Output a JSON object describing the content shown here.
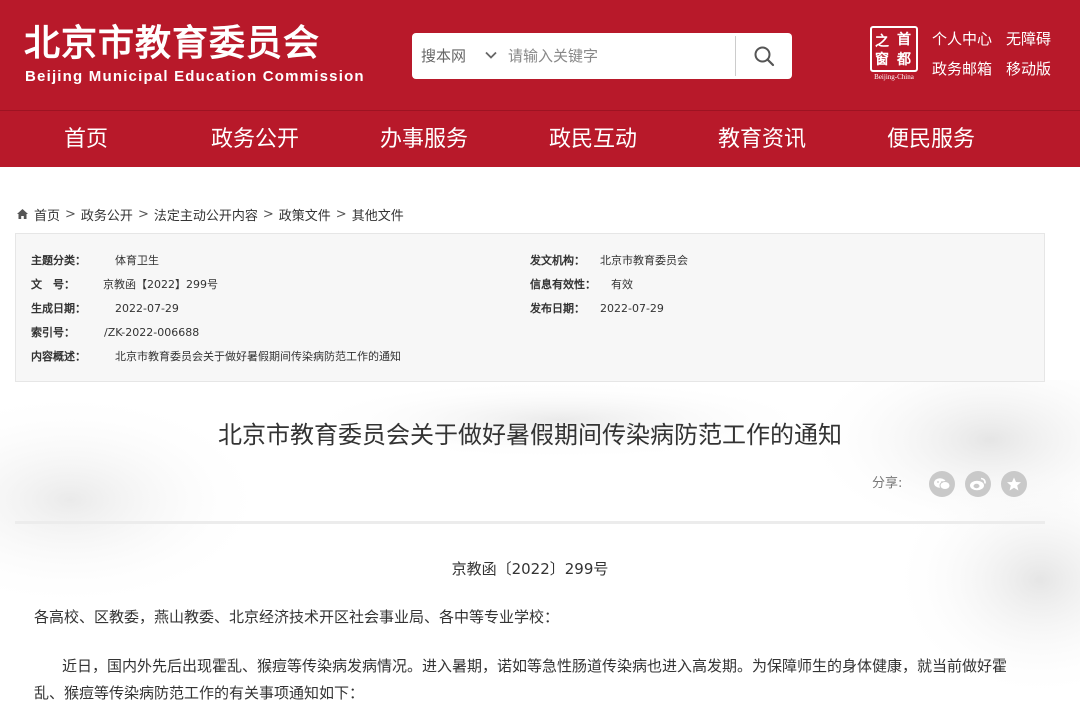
{
  "header": {
    "logo_cn": "北京市教育委员会",
    "logo_en": "Beijing Municipal Education Commission",
    "search": {
      "scope": "搜本网",
      "placeholder": "请输入关键字"
    },
    "seal": {
      "chars": [
        "之",
        "首",
        "窗",
        "都"
      ],
      "caption": "Beijing-China"
    },
    "links": {
      "personal": "个人中心",
      "accessible": "无障碍",
      "mail": "政务邮箱",
      "mobile": "移动版"
    }
  },
  "nav": [
    "首页",
    "政务公开",
    "办事服务",
    "政民互动",
    "教育资讯",
    "便民服务"
  ],
  "breadcrumb": [
    "首页",
    "政务公开",
    "法定主动公开内容",
    "政策文件",
    "其他文件"
  ],
  "meta": {
    "topic_label": "主题分类：",
    "topic": "体育卫生",
    "docno_label": "文　号：",
    "docno": "京教函【2022】299号",
    "created_label": "生成日期：",
    "created": "2022-07-29",
    "index_label": "索引号：",
    "index": "/ZK-2022-006688",
    "summary_label": "内容概述：",
    "summary": "北京市教育委员会关于做好暑假期间传染病防范工作的通知",
    "issuer_label": "发文机构：",
    "issuer": "北京市教育委员会",
    "validity_label": "信息有效性：",
    "validity": "有效",
    "published_label": "发布日期：",
    "published": "2022-07-29"
  },
  "article": {
    "title": "北京市教育委员会关于做好暑假期间传染病防范工作的通知",
    "share_label": "分享:",
    "doc_number": "京教函〔2022〕299号",
    "salutation": "各高校、区教委，燕山教委、北京经济技术开区社会事业局、各中等专业学校：",
    "body_line1": "近日，国内外先后出现霍乱、猴痘等传染病发病情况。进入暑期，诺如等急性肠道传染病也进入高发期。为保障师生的身体健康，就当前做好霍",
    "body_line2": "乱、猴痘等传染病防范工作的有关事项通知如下："
  },
  "colors": {
    "brand": "#b8192a",
    "meta_bg": "#f7f7f7",
    "share_icon": "#c9c9c9"
  }
}
